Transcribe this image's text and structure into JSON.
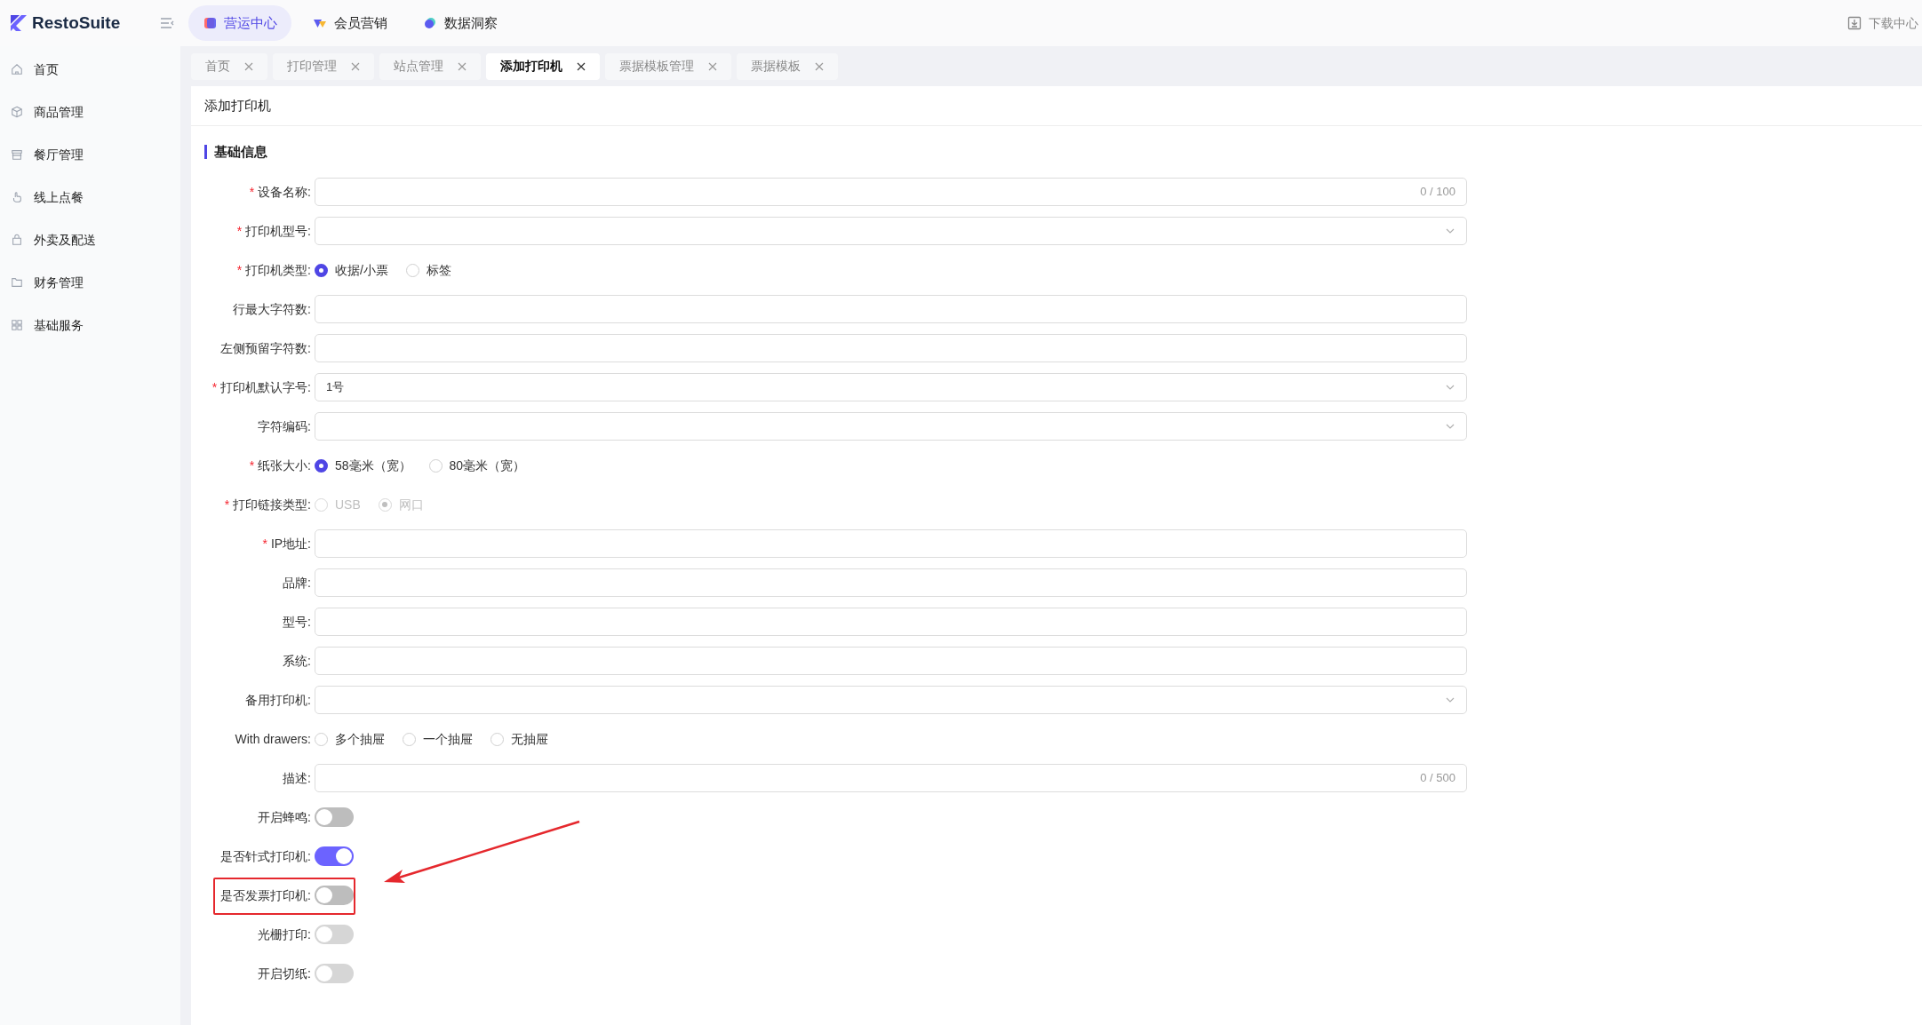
{
  "app": {
    "logo": "RestoSuite",
    "download": "下载中心"
  },
  "nav": [
    {
      "label": "营运中心",
      "selected": true
    },
    {
      "label": "会员营销",
      "selected": false
    },
    {
      "label": "数据洞察",
      "selected": false
    }
  ],
  "sidebar": {
    "items": [
      {
        "label": "首页"
      },
      {
        "label": "商品管理"
      },
      {
        "label": "餐厅管理"
      },
      {
        "label": "线上点餐"
      },
      {
        "label": "外卖及配送"
      },
      {
        "label": "财务管理"
      },
      {
        "label": "基础服务"
      }
    ]
  },
  "tabs": [
    {
      "label": "首页",
      "selected": false
    },
    {
      "label": "打印管理",
      "selected": false
    },
    {
      "label": "站点管理",
      "selected": false
    },
    {
      "label": "添加打印机",
      "selected": true
    },
    {
      "label": "票据模板管理",
      "selected": false
    },
    {
      "label": "票据模板",
      "selected": false
    }
  ],
  "page": {
    "title": "添加打印机",
    "section": "基础信息"
  },
  "form": [
    {
      "kind": "text",
      "label": "设备名称:",
      "required_mark": "*",
      "counter": "0 / 100"
    },
    {
      "kind": "select",
      "label": "打印机型号:",
      "required_mark": "*"
    },
    {
      "kind": "radio",
      "label": "打印机类型:",
      "required_mark": "*",
      "disabled": false,
      "options": [
        {
          "label": "收据/小票",
          "selected": true
        },
        {
          "label": "标签",
          "selected": false
        }
      ]
    },
    {
      "kind": "text",
      "label": "行最大字符数:"
    },
    {
      "kind": "text",
      "label": "左侧预留字符数:"
    },
    {
      "kind": "select",
      "label": "打印机默认字号:",
      "required_mark": "*",
      "value": "1号"
    },
    {
      "kind": "select",
      "label": "字符编码:"
    },
    {
      "kind": "radio",
      "label": "纸张大小:",
      "required_mark": "*",
      "disabled": false,
      "options": [
        {
          "label": "58毫米（宽）",
          "selected": true
        },
        {
          "label": "80毫米（宽）",
          "selected": false
        }
      ]
    },
    {
      "kind": "radio",
      "label": "打印链接类型:",
      "required_mark": "*",
      "disabled": true,
      "options": [
        {
          "label": "USB",
          "selected": false
        },
        {
          "label": "网口",
          "selected": true
        }
      ]
    },
    {
      "kind": "text",
      "label": "IP地址:",
      "required_mark": "*"
    },
    {
      "kind": "text",
      "label": "品牌:"
    },
    {
      "kind": "text",
      "label": "型号:"
    },
    {
      "kind": "text",
      "label": "系统:"
    },
    {
      "kind": "select",
      "label": "备用打印机:"
    },
    {
      "kind": "radio",
      "label": "With drawers:",
      "disabled": false,
      "options": [
        {
          "label": "多个抽屉",
          "selected": false
        },
        {
          "label": "一个抽屉",
          "selected": false
        },
        {
          "label": "无抽屉",
          "selected": false
        }
      ]
    },
    {
      "kind": "text",
      "label": "描述:",
      "counter": "0 / 500"
    },
    {
      "kind": "switch",
      "label": "开启蜂鸣:",
      "on": false,
      "disabled": false,
      "highlighted": false
    },
    {
      "kind": "switch",
      "label": "是否针式打印机:",
      "on": true,
      "disabled": false,
      "highlighted": false
    },
    {
      "kind": "switch",
      "label": "是否发票打印机:",
      "on": false,
      "disabled": false,
      "highlighted": true
    },
    {
      "kind": "switch",
      "label": "光栅打印:",
      "on": false,
      "disabled": true,
      "highlighted": false
    },
    {
      "kind": "switch",
      "label": "开启切纸:",
      "on": false,
      "disabled": true,
      "highlighted": false
    }
  ]
}
